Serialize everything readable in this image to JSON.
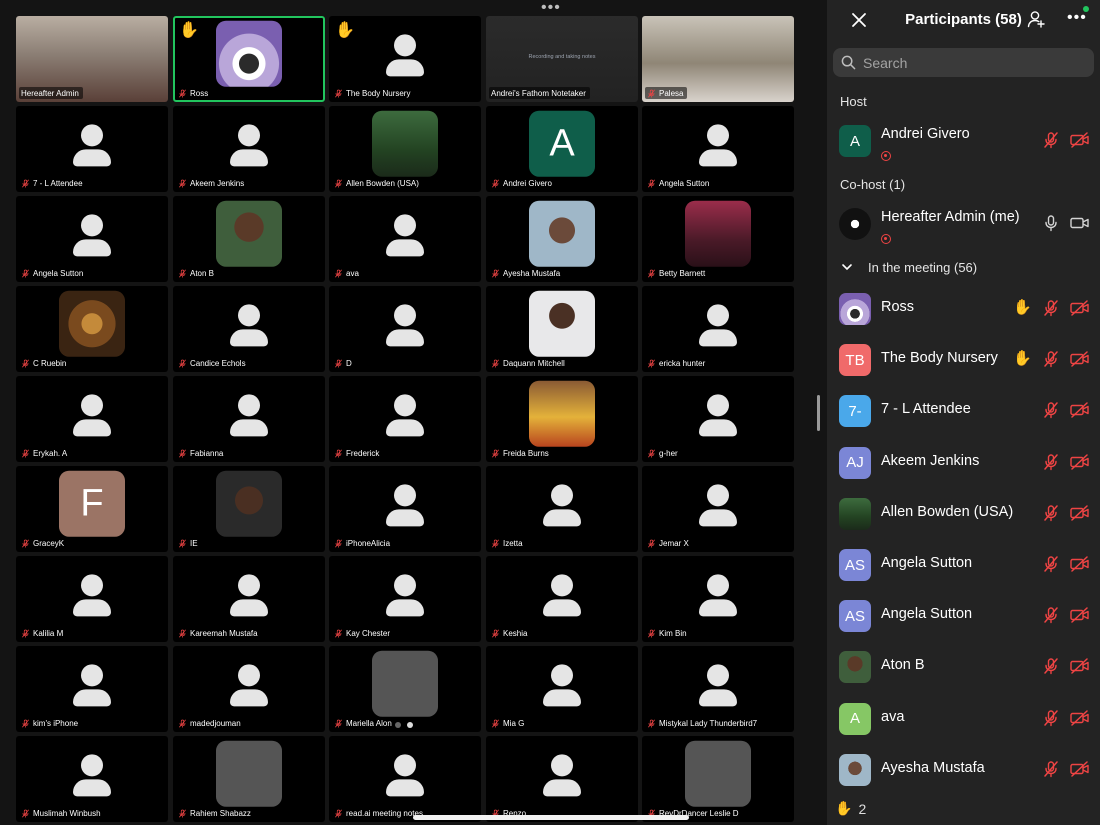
{
  "grid": {
    "tiles": [
      {
        "name": "Hereafter Admin",
        "type": "video",
        "muted": false
      },
      {
        "name": "Ross",
        "type": "photo",
        "muted": true,
        "hand": true,
        "speaking": true
      },
      {
        "name": "The Body Nursery",
        "type": "silhouette",
        "muted": true,
        "hand": true
      },
      {
        "name": "Andrei's Fathom Notetaker",
        "type": "screen",
        "muted": false,
        "overlay_text": "Recording and taking notes"
      },
      {
        "name": "Palesa",
        "type": "video",
        "muted": true
      },
      {
        "name": "7 - L Attendee",
        "type": "silhouette",
        "muted": true
      },
      {
        "name": "Akeem Jenkins",
        "type": "silhouette",
        "muted": true
      },
      {
        "name": "Allen Bowden (USA)",
        "type": "photo",
        "muted": true
      },
      {
        "name": "Andrei Givero",
        "type": "letter",
        "letter": "A",
        "color": "#0f5e4a",
        "muted": true
      },
      {
        "name": "Angela Sutton",
        "type": "silhouette",
        "muted": true
      },
      {
        "name": "Angela Sutton",
        "type": "silhouette",
        "muted": true
      },
      {
        "name": "Aton B",
        "type": "photo",
        "muted": true
      },
      {
        "name": "ava",
        "type": "silhouette",
        "muted": true
      },
      {
        "name": "Ayesha Mustafa",
        "type": "photo",
        "muted": true
      },
      {
        "name": "Betty Barnett",
        "type": "photo",
        "muted": true
      },
      {
        "name": "C Ruebin",
        "type": "photo",
        "muted": true
      },
      {
        "name": "Candice Echols",
        "type": "silhouette",
        "muted": true
      },
      {
        "name": "D",
        "type": "silhouette",
        "muted": true
      },
      {
        "name": "Daquann Mitchell",
        "type": "photo",
        "muted": true
      },
      {
        "name": "ericka hunter",
        "type": "silhouette",
        "muted": true
      },
      {
        "name": "Erykah. A",
        "type": "silhouette",
        "muted": true
      },
      {
        "name": "Fabianna",
        "type": "silhouette",
        "muted": true
      },
      {
        "name": "Frederick",
        "type": "silhouette",
        "muted": true
      },
      {
        "name": "Freida Burns",
        "type": "photo",
        "muted": true
      },
      {
        "name": "g-her",
        "type": "silhouette",
        "muted": true
      },
      {
        "name": "GraceyK",
        "type": "letter",
        "letter": "F",
        "color": "#9b7465",
        "muted": true
      },
      {
        "name": "IE",
        "type": "photo",
        "muted": true
      },
      {
        "name": "iPhoneAlicia",
        "type": "silhouette",
        "muted": true
      },
      {
        "name": "Izetta",
        "type": "silhouette",
        "muted": true
      },
      {
        "name": "Jemar X",
        "type": "silhouette",
        "muted": true
      },
      {
        "name": "Kalilia M",
        "type": "silhouette",
        "muted": true
      },
      {
        "name": "Kareemah Mustafa",
        "type": "silhouette",
        "muted": true
      },
      {
        "name": "Kay Chester",
        "type": "silhouette",
        "muted": true
      },
      {
        "name": "Keshia",
        "type": "silhouette",
        "muted": true
      },
      {
        "name": "Kim Bin",
        "type": "silhouette",
        "muted": true
      },
      {
        "name": "kim's iPhone",
        "type": "silhouette",
        "muted": true
      },
      {
        "name": "madedjouman",
        "type": "silhouette",
        "muted": true
      },
      {
        "name": "Mariella Alon",
        "type": "photo",
        "muted": true
      },
      {
        "name": "Mia G",
        "type": "silhouette",
        "muted": true
      },
      {
        "name": "Mistykal Lady Thunderbird7",
        "type": "silhouette",
        "muted": true
      },
      {
        "name": "Muslimah Winbush",
        "type": "silhouette",
        "muted": true
      },
      {
        "name": "Rahiem Shabazz",
        "type": "photo",
        "muted": true
      },
      {
        "name": "read.ai meeting notes",
        "type": "silhouette",
        "muted": true
      },
      {
        "name": "Renzo",
        "type": "silhouette",
        "muted": true
      },
      {
        "name": "RevDrDancer Leslie D",
        "type": "photo",
        "muted": true
      }
    ]
  },
  "sidebar": {
    "title": "Participants (58)",
    "search_placeholder": "Search",
    "host_label": "Host",
    "cohost_label": "Co-host (1)",
    "meeting_label": "In the meeting (56)",
    "host": {
      "name": "Andrei Givero",
      "initials": "A",
      "color": "#0f5e4a",
      "recording": true
    },
    "cohost": {
      "name": "Hereafter Admin (me)",
      "recording": true
    },
    "participants": [
      {
        "name": "Ross",
        "avatar": "photo",
        "hand": true
      },
      {
        "name": "The Body Nursery",
        "initials": "TB",
        "color": "#f06a6a",
        "hand": true
      },
      {
        "name": "7 - L Attendee",
        "initials": "7-",
        "color": "#4aa8ea",
        "hand": false
      },
      {
        "name": "Akeem Jenkins",
        "initials": "AJ",
        "color": "#7b86d6",
        "hand": false
      },
      {
        "name": "Allen Bowden (USA)",
        "avatar": "photo",
        "hand": false
      },
      {
        "name": "Angela Sutton",
        "initials": "AS",
        "color": "#7b86d6",
        "hand": false
      },
      {
        "name": "Angela Sutton",
        "initials": "AS",
        "color": "#7b86d6",
        "hand": false
      },
      {
        "name": "Aton B",
        "avatar": "photo",
        "hand": false
      },
      {
        "name": "ava",
        "initials": "A",
        "color": "#86c765",
        "hand": false
      },
      {
        "name": "Ayesha Mustafa",
        "avatar": "photo",
        "hand": false
      }
    ],
    "raised_hands_count": "2"
  },
  "colors": {
    "accent_green": "#22c55e",
    "mute_red": "#ef4444",
    "sidebar_bg": "#232323"
  }
}
